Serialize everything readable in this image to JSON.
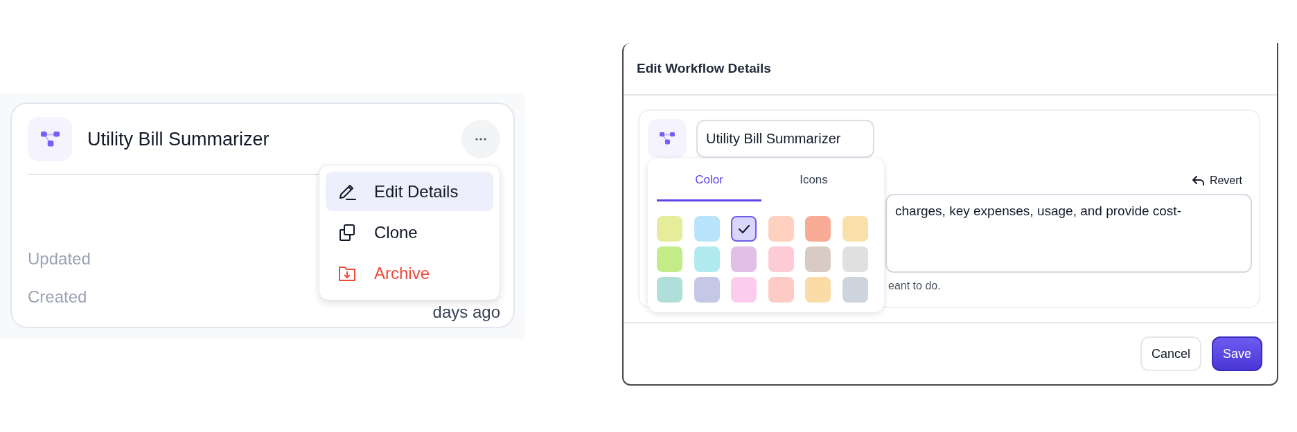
{
  "card": {
    "title": "Utility Bill Summarizer",
    "meta": [
      {
        "label": "Updated"
      },
      {
        "label": "Created",
        "value": "days ago"
      }
    ]
  },
  "menu": {
    "items": [
      {
        "label": "Edit Details",
        "kind": "edit",
        "selected": true
      },
      {
        "label": "Clone",
        "kind": "clone",
        "selected": false
      },
      {
        "label": "Archive",
        "kind": "archive",
        "selected": false
      }
    ]
  },
  "dialog": {
    "title": "Edit Workflow Details",
    "name_field": {
      "value": "Utility Bill Summarizer"
    },
    "revert": "Revert",
    "description": {
      "value": "charges, key expenses, usage, and provide cost-"
    },
    "helper": "eant to do.",
    "buttons": [
      {
        "label": "Cancel",
        "kind": "secondary"
      },
      {
        "label": "Save",
        "kind": "primary"
      }
    ]
  },
  "picker": {
    "tabs": [
      {
        "label": "Color",
        "selected": true
      },
      {
        "label": "Icons",
        "selected": false
      }
    ],
    "swatches": [
      {
        "color": "#e5ec9a",
        "selected": false
      },
      {
        "color": "#b9e4fb",
        "selected": false
      },
      {
        "color": "#d9d6fb",
        "selected": true
      },
      {
        "color": "#fdd0bf",
        "selected": false
      },
      {
        "color": "#f8ab95",
        "selected": false
      },
      {
        "color": "#f9dfaa",
        "selected": false
      },
      {
        "color": "#c3ec89",
        "selected": false
      },
      {
        "color": "#b1ebf0",
        "selected": false
      },
      {
        "color": "#e1bfe6",
        "selected": false
      },
      {
        "color": "#fdcbd5",
        "selected": false
      },
      {
        "color": "#d8cbc6",
        "selected": false
      },
      {
        "color": "#e0e0e0",
        "selected": false
      },
      {
        "color": "#b0ded8",
        "selected": false
      },
      {
        "color": "#c4c8e6",
        "selected": false
      },
      {
        "color": "#fbccec",
        "selected": false
      },
      {
        "color": "#fdcbc6",
        "selected": false
      },
      {
        "color": "#fbdba6",
        "selected": false
      },
      {
        "color": "#cdd4de",
        "selected": false
      }
    ]
  }
}
